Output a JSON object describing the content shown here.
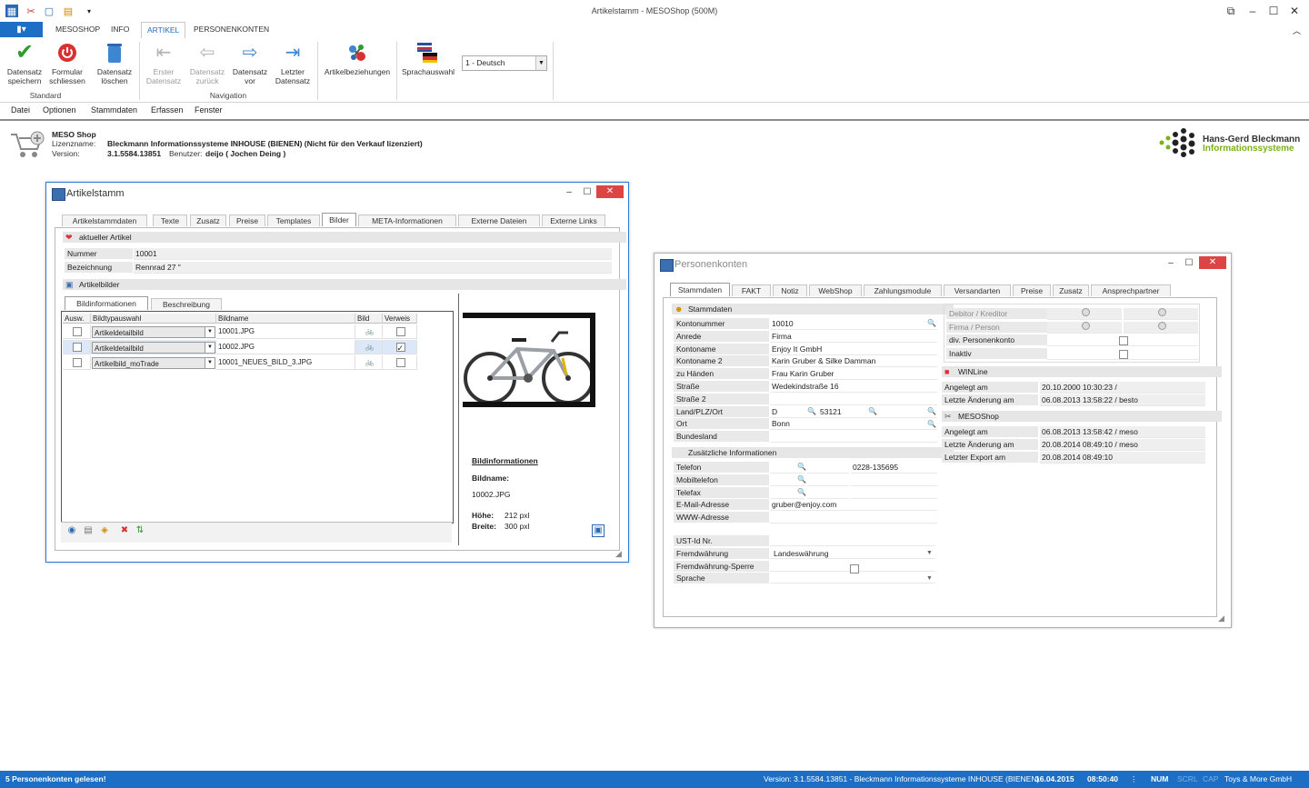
{
  "window": {
    "title": "Artikelstamm - MESOShop (500M)"
  },
  "ribbon": {
    "file_button": "▮▾",
    "tabs": [
      "MESOSHOP",
      "INFO",
      "ARTIKEL",
      "PERSONENKONTEN"
    ],
    "active_tab": "ARTIKEL",
    "buttons": {
      "save": "Datensatz\nspeichern",
      "close": "Formular\nschliessen",
      "delete": "Datensatz\nlöschen",
      "first": "Erster\nDatensatz",
      "prev": "Datensatz\nzurück",
      "next": "Datensatz\nvor",
      "last": "Letzter\nDatensatz",
      "relations": "Artikelbeziehungen",
      "language": "Sprachauswahl"
    },
    "groups": {
      "standard": "Standard",
      "navigation": "Navigation"
    },
    "language_select": "1 - Deutsch"
  },
  "menu": [
    "Datei",
    "Optionen",
    "Stammdaten",
    "Erfassen",
    "Fenster"
  ],
  "info": {
    "title": "MESO Shop",
    "license_label": "Lizenzname:",
    "license_value": "Bleckmann Informationssysteme INHOUSE (BIENEN) (Nicht für den Verkauf lizenziert)",
    "version_label": "Version:",
    "version_value": "3.1.5584.13851",
    "user_label": "Benutzer:",
    "user_value": "deijo ( Jochen Deing )",
    "logo_line1": "Hans-Gerd Bleckmann",
    "logo_line2": "Informationssysteme"
  },
  "artikel": {
    "title": "Artikelstamm",
    "tabs": [
      "Artikelstammdaten",
      "Texte",
      "Zusatz",
      "Preise",
      "Templates",
      "Bilder",
      "META-Informationen",
      "Externe Dateien",
      "Externe Links"
    ],
    "current_header": "aktueller Artikel",
    "nummer_label": "Nummer",
    "nummer_value": "10001",
    "bezeichnung_label": "Bezeichnung",
    "bezeichnung_value": "Rennrad 27 \"",
    "images_header": "Artikelbilder",
    "subtabs": [
      "Bildinformationen",
      "Beschreibung"
    ],
    "grid_headers": [
      "Ausw.",
      "Bildtypauswahl",
      "Bildname",
      "Bild",
      "Verweis"
    ],
    "rows": [
      {
        "type": "Artikeldetailbild",
        "name": "10001.JPG",
        "checked": false
      },
      {
        "type": "Artikeldetailbild",
        "name": "10002.JPG",
        "checked": true
      },
      {
        "type": "Artikelbild_moTrade",
        "name": "10001_NEUES_BILD_3.JPG",
        "checked": false
      }
    ],
    "bildinfo_title": "Bildinformationen",
    "bildname_label": "Bildname:",
    "bildname_value": "10002.JPG",
    "hoehe_label": "Höhe:",
    "hoehe_value": "212 pxl",
    "breite_label": "Breite:",
    "breite_value": "300 pxl"
  },
  "personen": {
    "title": "Personenkonten",
    "tabs": [
      "Stammdaten",
      "FAKT",
      "Notiz",
      "WebShop",
      "Zahlungsmodule",
      "Versandarten",
      "Preise",
      "Zusatz",
      "Ansprechpartner"
    ],
    "stamm_header": "Stammdaten",
    "fields": [
      {
        "label": "Kontonummer",
        "value": "10010"
      },
      {
        "label": "Anrede",
        "value": "Firma"
      },
      {
        "label": "Kontoname",
        "value": "Enjoy It GmbH"
      },
      {
        "label": "Kontoname 2",
        "value": "Karin Gruber & Silke Damman"
      },
      {
        "label": "zu Händen",
        "value": "Frau Karin Gruber"
      },
      {
        "label": "Straße",
        "value": "Wedekindstraße 16"
      },
      {
        "label": "Straße 2",
        "value": ""
      },
      {
        "label": "Land/PLZ/Ort",
        "value": "D"
      },
      {
        "label": "Ort",
        "value": "Bonn"
      },
      {
        "label": "Bundesland",
        "value": ""
      }
    ],
    "plz_value": "53121",
    "zusatz_header": "Zusätzliche Informationen",
    "contact_fields": [
      {
        "label": "Telefon",
        "value": "0228-135695"
      },
      {
        "label": "Mobiltelefon",
        "value": ""
      },
      {
        "label": "Telefax",
        "value": ""
      },
      {
        "label": "E-Mail-Adresse",
        "value": "gruber@enjoy.com"
      },
      {
        "label": "WWW-Adresse",
        "value": ""
      }
    ],
    "extra_fields": [
      {
        "label": "UST-Id Nr.",
        "value": ""
      },
      {
        "label": "Fremdwährung",
        "value": "Landeswährung"
      },
      {
        "label": "Fremdwährung-Sperre",
        "value": ""
      },
      {
        "label": "Sprache",
        "value": ""
      }
    ],
    "right_labels": [
      "Debitor / Kreditor",
      "Firma / Person",
      "div. Personenkonto",
      "Inaktiv"
    ],
    "winline_header": "WINLine",
    "winline": [
      {
        "label": "Angelegt am",
        "value": "20.10.2000 10:30:23 /"
      },
      {
        "label": "Letzte Änderung am",
        "value": "06.08.2013 13:58:22 / besto"
      }
    ],
    "mesoshop_header": "MESOShop",
    "mesoshop": [
      {
        "label": "Angelegt am",
        "value": "06.08.2013 13:58:42 / meso"
      },
      {
        "label": "Letzte Änderung am",
        "value": "20.08.2014 08:49:10 / meso"
      },
      {
        "label": "Letzter Export am",
        "value": "20.08.2014 08:49:10"
      }
    ]
  },
  "status": {
    "left": "5 Personenkonten gelesen!",
    "version": "Version: 3.1.5584.13851 - Bleckmann Informationssysteme INHOUSE (BIENEN)",
    "date": "16.04.2015",
    "time": "08:50:40",
    "num": "NUM",
    "scrl": "SCRL",
    "cap": "CAP",
    "company": "Toys & More GmbH"
  }
}
